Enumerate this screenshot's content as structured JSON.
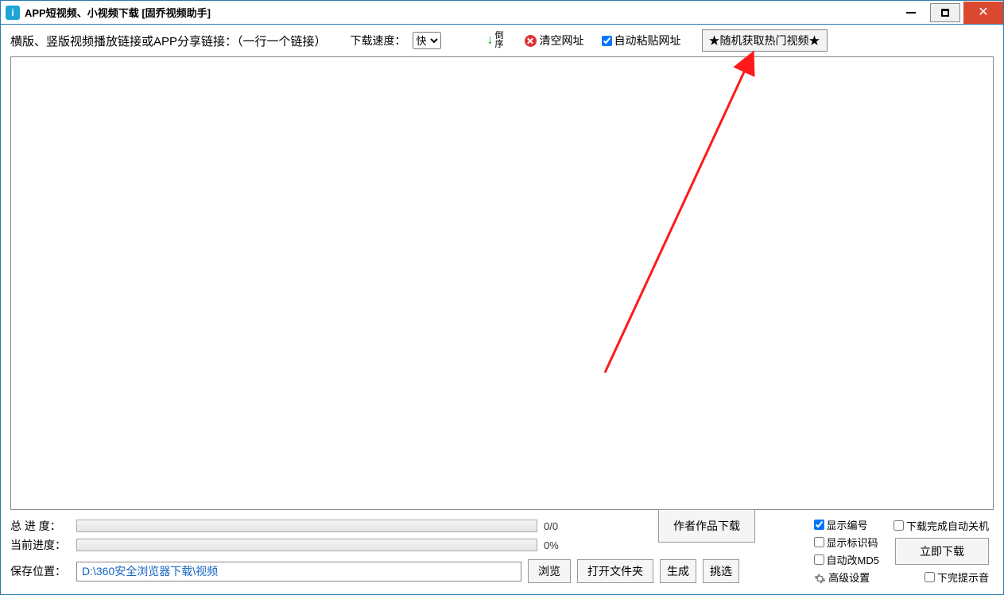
{
  "title": "APP短视频、小视频下载 [固乔视频助手]",
  "toolbar": {
    "main_label": "横版、竖版视频播放链接或APP分享链接：（一行一个链接）",
    "speed_label": "下载速度：",
    "speed_value": "快",
    "reverse_label": "倒\n序",
    "clear_label": "清空网址",
    "auto_paste_label": "自动粘贴网址",
    "hot_label": "★随机获取热门视频★"
  },
  "bottom": {
    "total_label": "总 进 度：",
    "total_text": "0/0",
    "current_label": "当前进度：",
    "current_text": "0%",
    "path_label": "保存位置：",
    "path_value": "D:\\360安全浏览器下载\\视频",
    "browse_btn": "浏览",
    "open_folder_btn": "打开文件夹",
    "gen_btn": "生成",
    "pick_btn": "挑选",
    "author_btn": "作者作品下载"
  },
  "options": {
    "show_number": "显示编号",
    "show_id": "显示标识码",
    "auto_md5": "自动改MD5",
    "advanced": "高级设置",
    "auto_shutdown": "下载完成自动关机",
    "download_now": "立即下载",
    "sound_done": "下完提示音"
  }
}
